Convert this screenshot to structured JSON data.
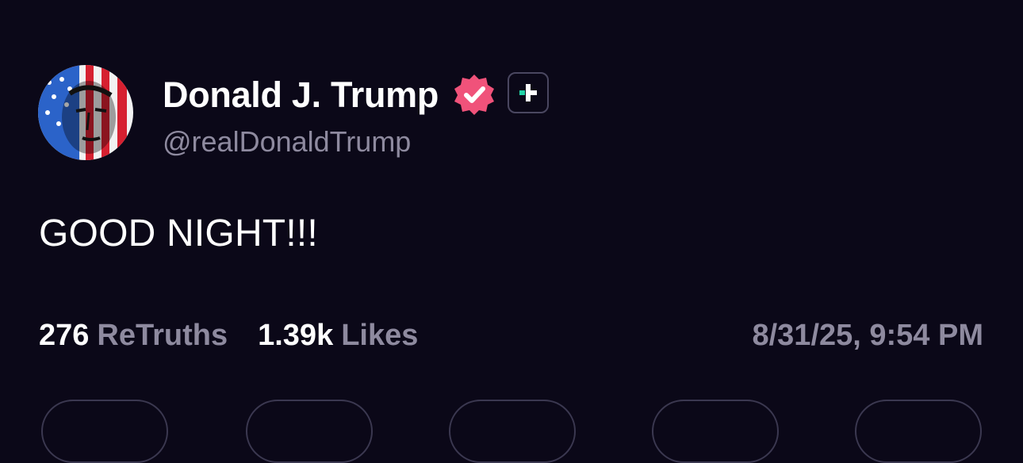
{
  "author": {
    "name": "Donald J. Trump",
    "handle": "@realDonaldTrump",
    "verified_color": "#f0527a",
    "badge_accent": "#23d3a8"
  },
  "post": {
    "text": "GOOD NIGHT!!!",
    "timestamp": "8/31/25, 9:54 PM"
  },
  "stats": {
    "retruths_count": "276",
    "retruths_label": "ReTruths",
    "likes_count": "1.39k",
    "likes_label": "Likes"
  },
  "actions": [
    {
      "icon": "reply-icon"
    },
    {
      "icon": "retruth-icon"
    },
    {
      "icon": "like-icon"
    },
    {
      "icon": "bookmark-icon"
    },
    {
      "icon": "share-icon"
    }
  ],
  "colors": {
    "background": "#0b0818",
    "text": "#ffffff",
    "muted": "#8e8a9f"
  }
}
